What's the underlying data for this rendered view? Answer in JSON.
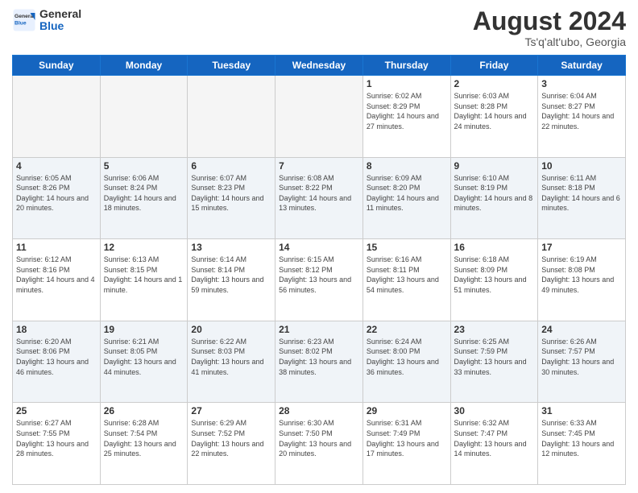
{
  "header": {
    "logo_line1": "General",
    "logo_line2": "Blue",
    "month_year": "August 2024",
    "location": "Ts'q'alt'ubo, Georgia"
  },
  "days_of_week": [
    "Sunday",
    "Monday",
    "Tuesday",
    "Wednesday",
    "Thursday",
    "Friday",
    "Saturday"
  ],
  "weeks": [
    [
      {
        "day": "",
        "empty": true
      },
      {
        "day": "",
        "empty": true
      },
      {
        "day": "",
        "empty": true
      },
      {
        "day": "",
        "empty": true
      },
      {
        "day": "1",
        "sunrise": "6:02 AM",
        "sunset": "8:29 PM",
        "daylight": "14 hours and 27 minutes."
      },
      {
        "day": "2",
        "sunrise": "6:03 AM",
        "sunset": "8:28 PM",
        "daylight": "14 hours and 24 minutes."
      },
      {
        "day": "3",
        "sunrise": "6:04 AM",
        "sunset": "8:27 PM",
        "daylight": "14 hours and 22 minutes."
      }
    ],
    [
      {
        "day": "4",
        "sunrise": "6:05 AM",
        "sunset": "8:26 PM",
        "daylight": "14 hours and 20 minutes."
      },
      {
        "day": "5",
        "sunrise": "6:06 AM",
        "sunset": "8:24 PM",
        "daylight": "14 hours and 18 minutes."
      },
      {
        "day": "6",
        "sunrise": "6:07 AM",
        "sunset": "8:23 PM",
        "daylight": "14 hours and 15 minutes."
      },
      {
        "day": "7",
        "sunrise": "6:08 AM",
        "sunset": "8:22 PM",
        "daylight": "14 hours and 13 minutes."
      },
      {
        "day": "8",
        "sunrise": "6:09 AM",
        "sunset": "8:20 PM",
        "daylight": "14 hours and 11 minutes."
      },
      {
        "day": "9",
        "sunrise": "6:10 AM",
        "sunset": "8:19 PM",
        "daylight": "14 hours and 8 minutes."
      },
      {
        "day": "10",
        "sunrise": "6:11 AM",
        "sunset": "8:18 PM",
        "daylight": "14 hours and 6 minutes."
      }
    ],
    [
      {
        "day": "11",
        "sunrise": "6:12 AM",
        "sunset": "8:16 PM",
        "daylight": "14 hours and 4 minutes."
      },
      {
        "day": "12",
        "sunrise": "6:13 AM",
        "sunset": "8:15 PM",
        "daylight": "14 hours and 1 minute."
      },
      {
        "day": "13",
        "sunrise": "6:14 AM",
        "sunset": "8:14 PM",
        "daylight": "13 hours and 59 minutes."
      },
      {
        "day": "14",
        "sunrise": "6:15 AM",
        "sunset": "8:12 PM",
        "daylight": "13 hours and 56 minutes."
      },
      {
        "day": "15",
        "sunrise": "6:16 AM",
        "sunset": "8:11 PM",
        "daylight": "13 hours and 54 minutes."
      },
      {
        "day": "16",
        "sunrise": "6:18 AM",
        "sunset": "8:09 PM",
        "daylight": "13 hours and 51 minutes."
      },
      {
        "day": "17",
        "sunrise": "6:19 AM",
        "sunset": "8:08 PM",
        "daylight": "13 hours and 49 minutes."
      }
    ],
    [
      {
        "day": "18",
        "sunrise": "6:20 AM",
        "sunset": "8:06 PM",
        "daylight": "13 hours and 46 minutes."
      },
      {
        "day": "19",
        "sunrise": "6:21 AM",
        "sunset": "8:05 PM",
        "daylight": "13 hours and 44 minutes."
      },
      {
        "day": "20",
        "sunrise": "6:22 AM",
        "sunset": "8:03 PM",
        "daylight": "13 hours and 41 minutes."
      },
      {
        "day": "21",
        "sunrise": "6:23 AM",
        "sunset": "8:02 PM",
        "daylight": "13 hours and 38 minutes."
      },
      {
        "day": "22",
        "sunrise": "6:24 AM",
        "sunset": "8:00 PM",
        "daylight": "13 hours and 36 minutes."
      },
      {
        "day": "23",
        "sunrise": "6:25 AM",
        "sunset": "7:59 PM",
        "daylight": "13 hours and 33 minutes."
      },
      {
        "day": "24",
        "sunrise": "6:26 AM",
        "sunset": "7:57 PM",
        "daylight": "13 hours and 30 minutes."
      }
    ],
    [
      {
        "day": "25",
        "sunrise": "6:27 AM",
        "sunset": "7:55 PM",
        "daylight": "13 hours and 28 minutes."
      },
      {
        "day": "26",
        "sunrise": "6:28 AM",
        "sunset": "7:54 PM",
        "daylight": "13 hours and 25 minutes."
      },
      {
        "day": "27",
        "sunrise": "6:29 AM",
        "sunset": "7:52 PM",
        "daylight": "13 hours and 22 minutes."
      },
      {
        "day": "28",
        "sunrise": "6:30 AM",
        "sunset": "7:50 PM",
        "daylight": "13 hours and 20 minutes."
      },
      {
        "day": "29",
        "sunrise": "6:31 AM",
        "sunset": "7:49 PM",
        "daylight": "13 hours and 17 minutes."
      },
      {
        "day": "30",
        "sunrise": "6:32 AM",
        "sunset": "7:47 PM",
        "daylight": "13 hours and 14 minutes."
      },
      {
        "day": "31",
        "sunrise": "6:33 AM",
        "sunset": "7:45 PM",
        "daylight": "13 hours and 12 minutes."
      }
    ]
  ]
}
